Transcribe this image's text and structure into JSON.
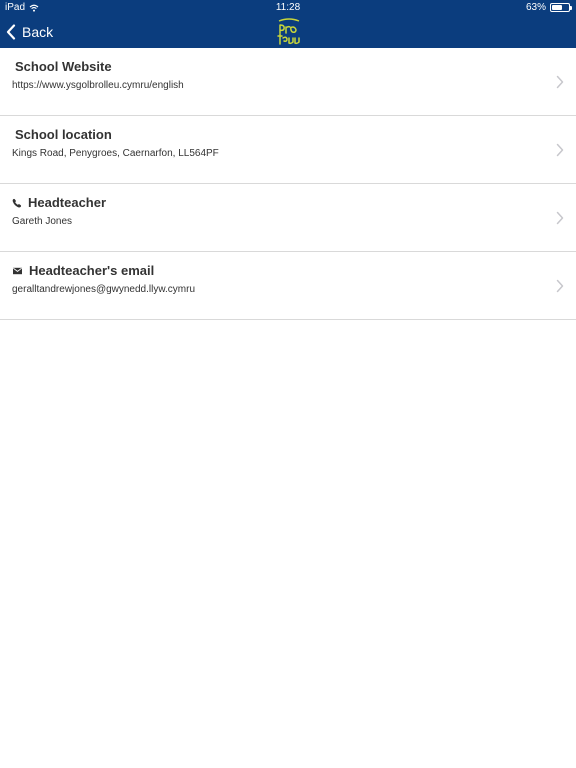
{
  "status": {
    "device": "iPad",
    "time": "11:28",
    "battery": "63%",
    "battery_level": 0.63
  },
  "nav": {
    "back_label": "Back",
    "logo_icon": "school-crest-logo"
  },
  "rows": [
    {
      "title": "School Website",
      "value": "https://www.ysgolbrolleu.cymru/english",
      "icon": ""
    },
    {
      "title": "School location",
      "value": "Kings Road, Penygroes, Caernarfon, LL564PF",
      "icon": ""
    },
    {
      "title": "Headteacher",
      "value": "Gareth Jones",
      "icon": "phone-icon"
    },
    {
      "title": "Headteacher's email",
      "value": "geralltandrewjones@gwynedd.llyw.cymru",
      "icon": "envelope-icon"
    }
  ],
  "colors": {
    "bar": "#0b3d7e",
    "logo": "#c8d63a",
    "chevron": "#c7c7cc",
    "text": "#333333"
  }
}
